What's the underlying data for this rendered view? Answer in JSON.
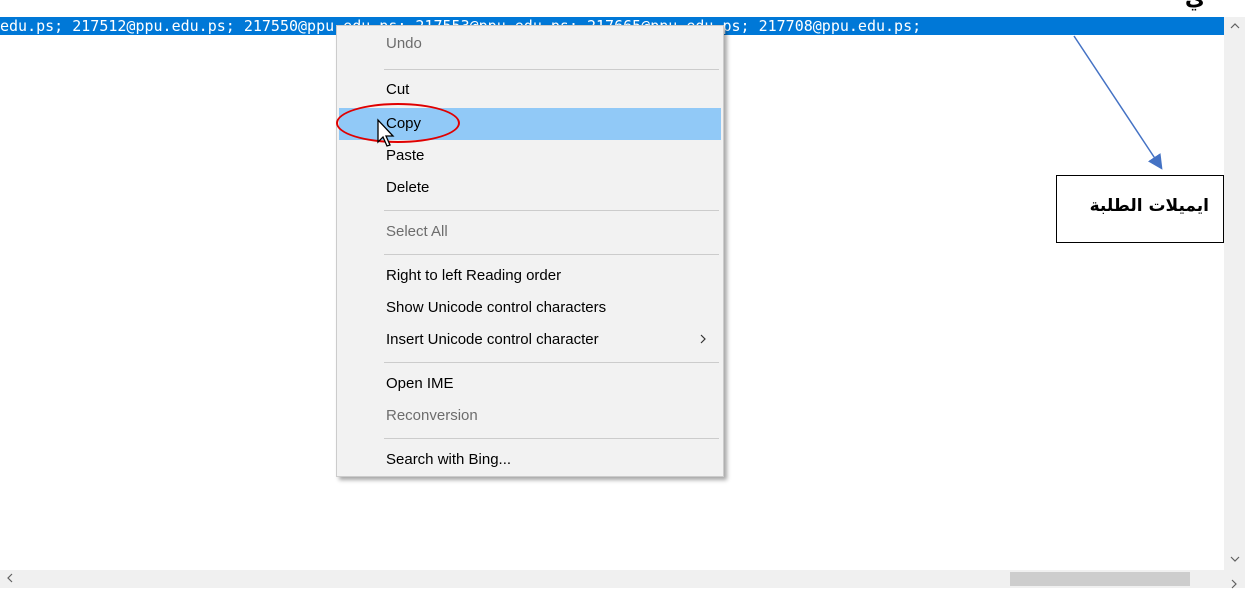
{
  "heading": {
    "text": "ي"
  },
  "selection": {
    "text": "edu.ps; 217512@ppu.edu.ps; 217550@ppu.edu.ps; 217553@ppu.edu.ps; 217665@ppu.edu.ps; 217708@ppu.edu.ps;"
  },
  "context_menu": {
    "items": [
      {
        "label": "Undo",
        "enabled": false
      },
      {
        "label": "Cut",
        "enabled": true
      },
      {
        "label": "Copy",
        "enabled": true,
        "highlighted": true
      },
      {
        "label": "Paste",
        "enabled": true
      },
      {
        "label": "Delete",
        "enabled": true
      },
      {
        "label": "Select All",
        "enabled": false
      },
      {
        "label": "Right to left Reading order",
        "enabled": true
      },
      {
        "label": "Show Unicode control characters",
        "enabled": true
      },
      {
        "label": "Insert Unicode control character",
        "enabled": true,
        "submenu_icon": "chevron-right-icon"
      },
      {
        "label": "Open IME",
        "enabled": true
      },
      {
        "label": "Reconversion",
        "enabled": false
      },
      {
        "label": "Search with Bing...",
        "enabled": true
      }
    ]
  },
  "annotation": {
    "callout_text": "ايميلات الطلبة",
    "highlight_color": "#e00000",
    "arrow_color": "#4472c4"
  },
  "scrollbars": {
    "vertical": {
      "up_icon": "chevron-up-icon",
      "down_icon": "chevron-down-icon"
    },
    "horizontal": {
      "left_icon": "chevron-left-icon",
      "right_icon": "chevron-right-icon"
    }
  },
  "colors": {
    "selection_bg": "#0078d7",
    "menu_highlight": "#91c9f7",
    "menu_bg": "#f2f2f2"
  }
}
